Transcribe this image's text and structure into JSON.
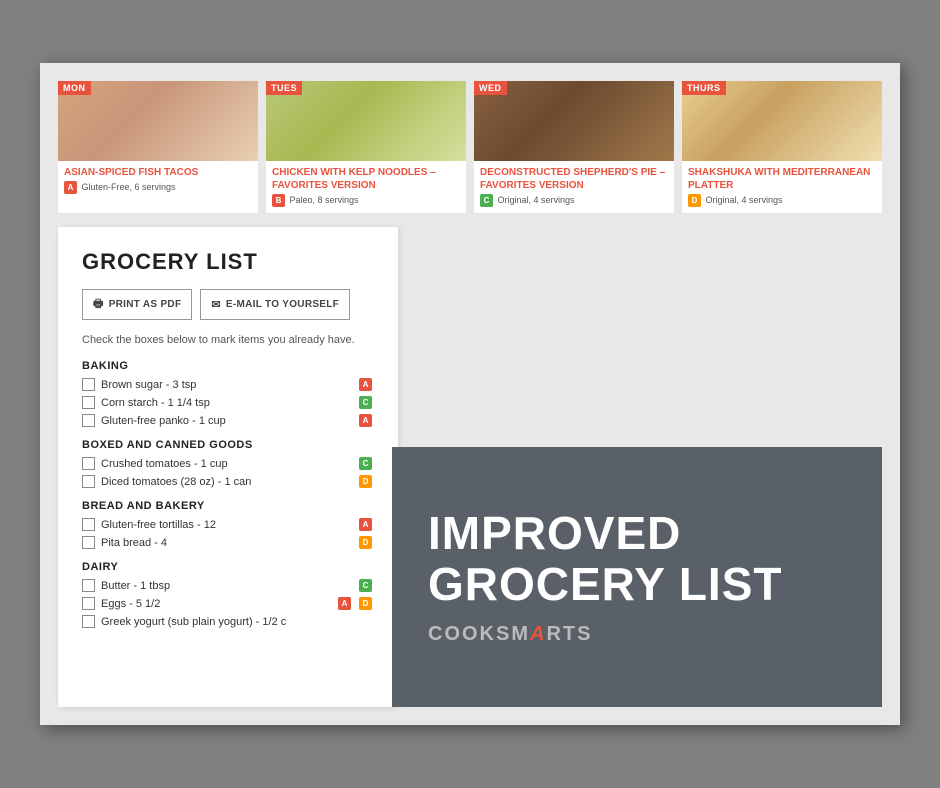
{
  "meals": [
    {
      "day": "MON",
      "title": "ASIAN-SPICED FISH TACOS",
      "badge": "A",
      "badge_class": "badge-a",
      "meta": "Gluten-Free, 6 servings",
      "img_class": "img-mon"
    },
    {
      "day": "TUES",
      "title": "CHICKEN WITH KELP NOODLES – FAVORITES VERSION",
      "badge": "B",
      "badge_class": "badge-b",
      "meta": "Paleo, 8 servings",
      "img_class": "img-tue"
    },
    {
      "day": "WED",
      "title": "DECONSTRUCTED SHEPHERD'S PIE – FAVORITES VERSION",
      "badge": "C",
      "badge_class": "badge-c",
      "meta": "Original, 4 servings",
      "img_class": "img-wed"
    },
    {
      "day": "THURS",
      "title": "SHAKSHUKA WITH MEDITERRANEAN PLATTER",
      "badge": "D",
      "badge_class": "badge-d",
      "meta": "Original, 4 servings",
      "img_class": "img-thu"
    }
  ],
  "grocery": {
    "title": "GROCERY LIST",
    "print_label": "PRINT AS PDF",
    "email_label": "E-MAIL TO YOURSELF",
    "instructions": "Check the boxes below to mark items you already have.",
    "sections": [
      {
        "name": "BAKING",
        "items": [
          {
            "text": "Brown sugar - 3 tsp",
            "badge": "A",
            "badge_class": "badge-a"
          },
          {
            "text": "Corn starch - 1 1/4 tsp",
            "badge": "C",
            "badge_class": "badge-c"
          },
          {
            "text": "Gluten-free panko - 1 cup",
            "badge": "A",
            "badge_class": "badge-a"
          }
        ]
      },
      {
        "name": "BOXED AND CANNED GOODS",
        "items": [
          {
            "text": "Crushed tomatoes - 1 cup",
            "badge": "C",
            "badge_class": "badge-c"
          },
          {
            "text": "Diced tomatoes (28 oz) - 1 can",
            "badge": "D",
            "badge_class": "badge-d"
          }
        ]
      },
      {
        "name": "BREAD AND BAKERY",
        "items": [
          {
            "text": "Gluten-free tortillas - 12",
            "badge": "A",
            "badge_class": "badge-a"
          },
          {
            "text": "Pita bread - 4",
            "badge": "D",
            "badge_class": "badge-d"
          }
        ]
      },
      {
        "name": "DAIRY",
        "items": [
          {
            "text": "Butter - 1 tbsp",
            "badge": "C",
            "badge_class": "badge-c"
          },
          {
            "text": "Eggs - 5 1/2",
            "badge2": true,
            "badge": "A",
            "badge_class": "badge-a",
            "badge2_val": "D",
            "badge2_class": "badge-d"
          },
          {
            "text": "Greek yogurt (sub plain yogurt) - 1/2 c",
            "badge": null
          }
        ]
      }
    ]
  },
  "overlay": {
    "line1": "IMPROVED",
    "line2": "GROCERY LIST",
    "brand": "COOKSMARTS"
  }
}
